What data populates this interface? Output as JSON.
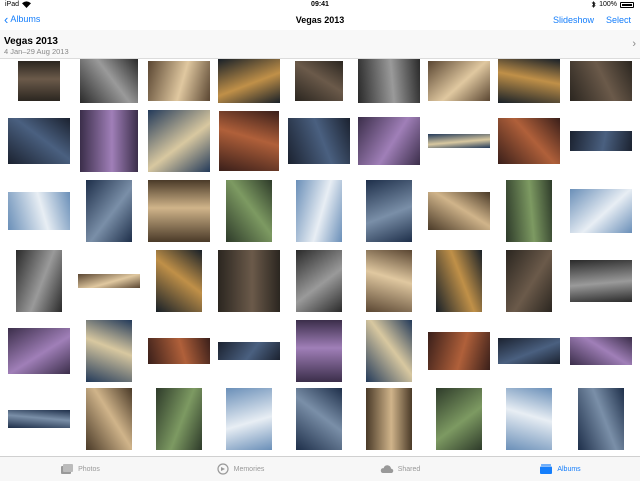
{
  "status": {
    "carrier": "iPad",
    "time": "09:41",
    "battery": "100%"
  },
  "nav": {
    "back_label": "Albums",
    "title": "Vegas 2013",
    "slideshow_label": "Slideshow",
    "select_label": "Select"
  },
  "header": {
    "title": "Vegas 2013",
    "subtitle": "4 Jan–29 Aug 2013"
  },
  "colors": {
    "accent": "#157efb",
    "tab_inactive": "#999999"
  },
  "tabs": [
    {
      "label": "Photos",
      "icon": "photos-icon",
      "active": false
    },
    {
      "label": "Memories",
      "icon": "memories-icon",
      "active": false
    },
    {
      "label": "Shared",
      "icon": "cloud-icon",
      "active": false
    },
    {
      "label": "Albums",
      "icon": "albums-icon",
      "active": true
    }
  ]
}
